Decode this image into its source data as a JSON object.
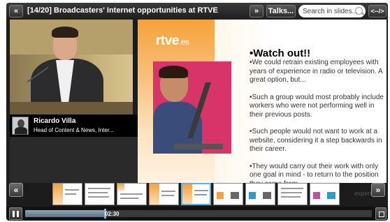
{
  "topbar": {
    "back_label": "«",
    "title": "[14/20] Broadcasters' Internet opportunities at RTVE",
    "next_label": "»",
    "talks_label": "Talks...",
    "search_placeholder": "Search in slides...",
    "share_label": "<--/>"
  },
  "speaker": {
    "name": "Ricardo Villa",
    "role": "Head of Content & News, Inter..."
  },
  "slide": {
    "logo_main": "rtve",
    "logo_sub": ".es",
    "title": "•Watch out!!",
    "bullets": [
      "•We could retrain existing employees with years of experience in radio or television. A great option, but...",
      "•Such a group would most probably include workers who were not performing well in their previous posts.",
      "•Such people would not want to work at a website, considering it a step backwards in their career.",
      "•They would carry out their work with only one goal in mind - to return to the position they came from."
    ]
  },
  "strip": {
    "prev_label": "«",
    "next_label": "»",
    "position_label": "6/20",
    "partial_text": "experience"
  },
  "controls": {
    "progress": 0.23,
    "time": "02:30"
  },
  "colors": {
    "accent_orange": "#f5a23a",
    "playhead_blue": "#6fc2ee",
    "selected_border": "#5ab3e0"
  }
}
